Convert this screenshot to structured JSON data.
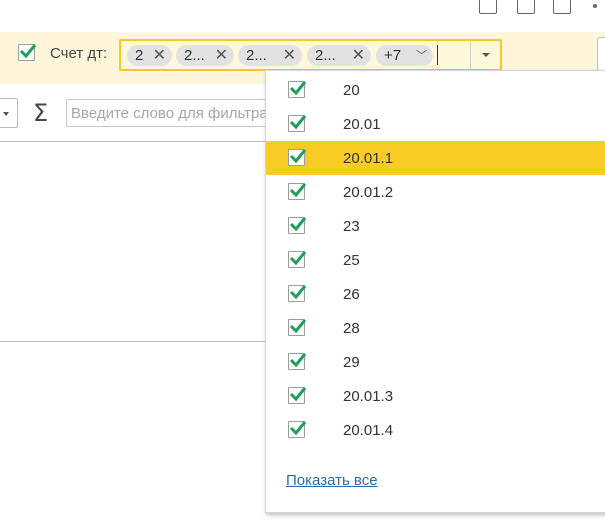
{
  "toolbar": {
    "icons": [
      "save-icon",
      "print-icon",
      "preview-icon",
      "more-icon"
    ]
  },
  "filter": {
    "checked": true,
    "label": "Счет дт:",
    "chips": [
      {
        "text": "2"
      },
      {
        "text": "2..."
      },
      {
        "text": "2..."
      },
      {
        "text": "2..."
      }
    ],
    "more_chip": "+7",
    "accent_color": "#f4c82a"
  },
  "search": {
    "placeholder": "Введите слово для фильтра"
  },
  "dropdown": {
    "highlight_color": "#f9cb25",
    "items": [
      {
        "value": "20",
        "checked": true
      },
      {
        "value": "20.01",
        "checked": true
      },
      {
        "value": "20.01.1",
        "checked": true,
        "selected": true
      },
      {
        "value": "20.01.2",
        "checked": true
      },
      {
        "value": "23",
        "checked": true
      },
      {
        "value": "25",
        "checked": true
      },
      {
        "value": "26",
        "checked": true
      },
      {
        "value": "28",
        "checked": true
      },
      {
        "value": "29",
        "checked": true
      },
      {
        "value": "20.01.3",
        "checked": true
      },
      {
        "value": "20.01.4",
        "checked": true
      }
    ],
    "show_all": "Показать все"
  }
}
